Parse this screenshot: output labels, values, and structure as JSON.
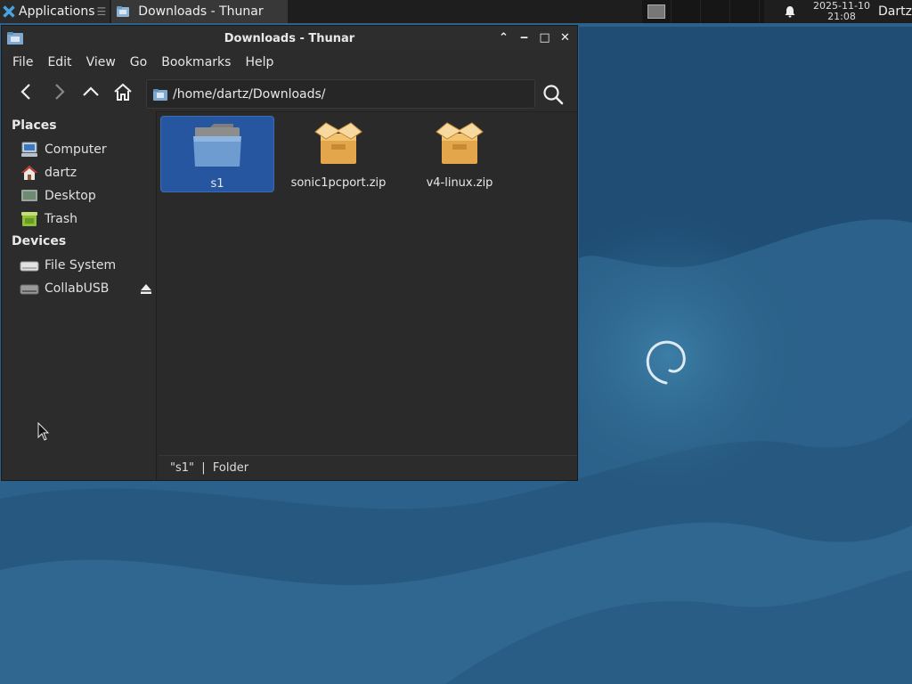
{
  "panel": {
    "applications_label": "Applications",
    "applications_sep": "☰",
    "task_label": "Downloads - Thunar",
    "clock_date": "2025-11-10",
    "clock_time": "21:08",
    "user": "Dartz"
  },
  "window": {
    "title": "Downloads - Thunar",
    "controls": {
      "minimize": "⌃",
      "iconify": "‒",
      "maximize": "□",
      "close": "✕"
    }
  },
  "menu": [
    "File",
    "Edit",
    "View",
    "Go",
    "Bookmarks",
    "Help"
  ],
  "location": {
    "path": "/home/dartz/Downloads/"
  },
  "sidebar": {
    "places_heading": "Places",
    "places": [
      {
        "label": "Computer",
        "icon": "computer-icon"
      },
      {
        "label": "dartz",
        "icon": "home-icon"
      },
      {
        "label": "Desktop",
        "icon": "desktop-icon"
      },
      {
        "label": "Trash",
        "icon": "trash-icon"
      }
    ],
    "devices_heading": "Devices",
    "devices": [
      {
        "label": "File System",
        "icon": "drive-icon"
      },
      {
        "label": "CollabUSB",
        "icon": "usb-drive-icon"
      }
    ]
  },
  "files": [
    {
      "name": "s1",
      "type": "folder",
      "selected": true
    },
    {
      "name": "sonic1pcport.zip",
      "type": "archive",
      "selected": false
    },
    {
      "name": "v4-linux.zip",
      "type": "archive",
      "selected": false
    }
  ],
  "status": {
    "text": "\"s1\"  |  Folder"
  },
  "colors": {
    "selection": "#2656a0",
    "panel_bg": "#1e1e1e",
    "window_bg": "#2c2c2c",
    "desktop": "#2a5f82"
  }
}
